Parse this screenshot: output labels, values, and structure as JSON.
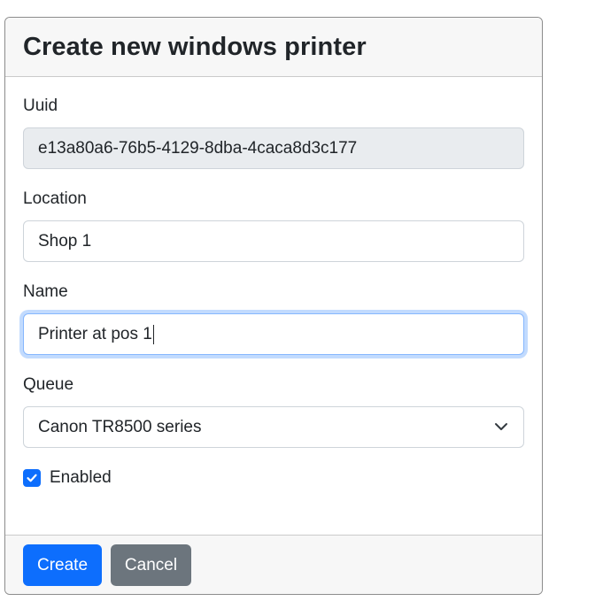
{
  "header": {
    "title": "Create new windows printer"
  },
  "form": {
    "uuid": {
      "label": "Uuid",
      "value": "e13a80a6-76b5-4129-8dba-4caca8d3c177"
    },
    "location": {
      "label": "Location",
      "value": "Shop 1"
    },
    "name": {
      "label": "Name",
      "value": "Printer at pos 1"
    },
    "queue": {
      "label": "Queue",
      "selected": "Canon TR8500 series"
    },
    "enabled": {
      "label": "Enabled",
      "checked": true
    }
  },
  "footer": {
    "create_label": "Create",
    "cancel_label": "Cancel"
  },
  "colors": {
    "primary": "#0d6efd",
    "secondary": "#6c757d",
    "readonly_bg": "#e9ecef",
    "focus_border": "#86b7fe"
  },
  "icons": {
    "select": "chevron-down-icon",
    "checkbox": "checkmark-icon"
  }
}
